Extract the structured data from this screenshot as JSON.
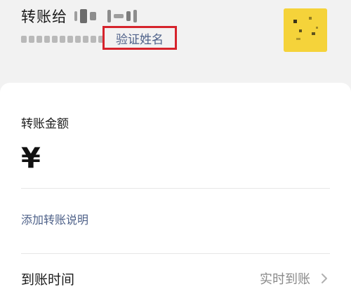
{
  "header": {
    "transfer_to_label": "转账给",
    "verify_name_button": "验证姓名",
    "verify_highlight_color": "#d6232c",
    "link_color": "#4e6189"
  },
  "avatar": {
    "color": "#f5d33a"
  },
  "amount": {
    "label": "转账金额",
    "currency_symbol": "¥",
    "value": ""
  },
  "note": {
    "add_label": "添加转账说明"
  },
  "arrival": {
    "label": "到账时间",
    "value": "实时到账",
    "chevron_icon": "chevron-right-icon"
  }
}
